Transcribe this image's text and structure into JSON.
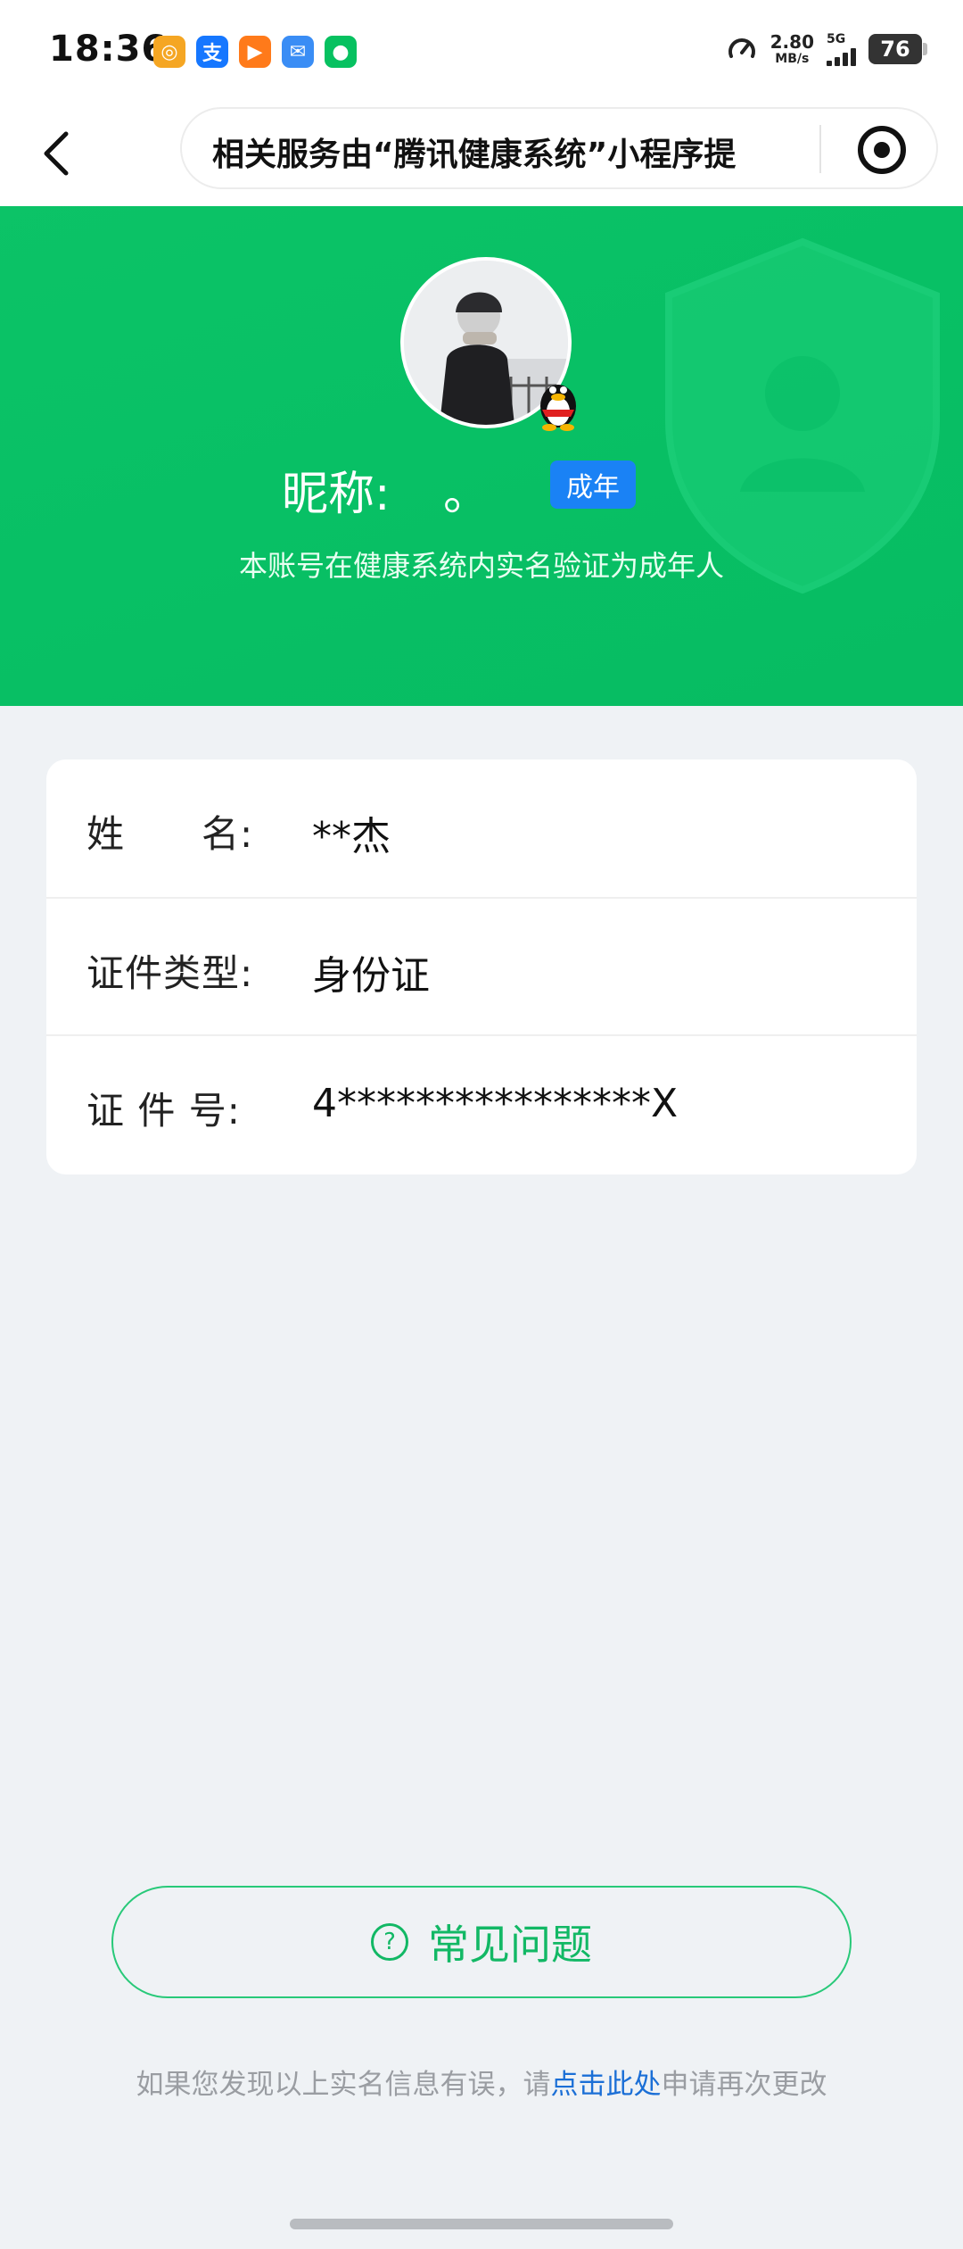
{
  "status_bar": {
    "time": "18:36",
    "app_icons": [
      "weibo-like-icon",
      "alipay-icon",
      "video-app-icon",
      "mail-app-icon",
      "wechat-icon"
    ],
    "net_speed_value": "2.80",
    "net_speed_unit": "MB/s",
    "network_type": "5G",
    "battery": "76"
  },
  "nav": {
    "title": "相关服务由“腾讯健康系统”小程序提"
  },
  "profile": {
    "nickname_label": "昵称:",
    "nickname_value": "。",
    "badge": "成年",
    "verify_note": "本账号在健康系统内实名验证为成年人"
  },
  "info": {
    "rows": [
      {
        "label": "姓　　名:",
        "value": "**杰"
      },
      {
        "label": "证件类型:",
        "value": "身份证"
      },
      {
        "label": "证 件 号:",
        "value": "4****************X"
      }
    ]
  },
  "faq": {
    "label": "常见问题"
  },
  "footer": {
    "prefix": "如果您发现以上实名信息有误，请",
    "link": "点击此处",
    "suffix": "申请再次更改"
  },
  "colors": {
    "brand_green": "#08c065",
    "badge_blue": "#1a82f5",
    "link_blue": "#1b6fd6"
  }
}
